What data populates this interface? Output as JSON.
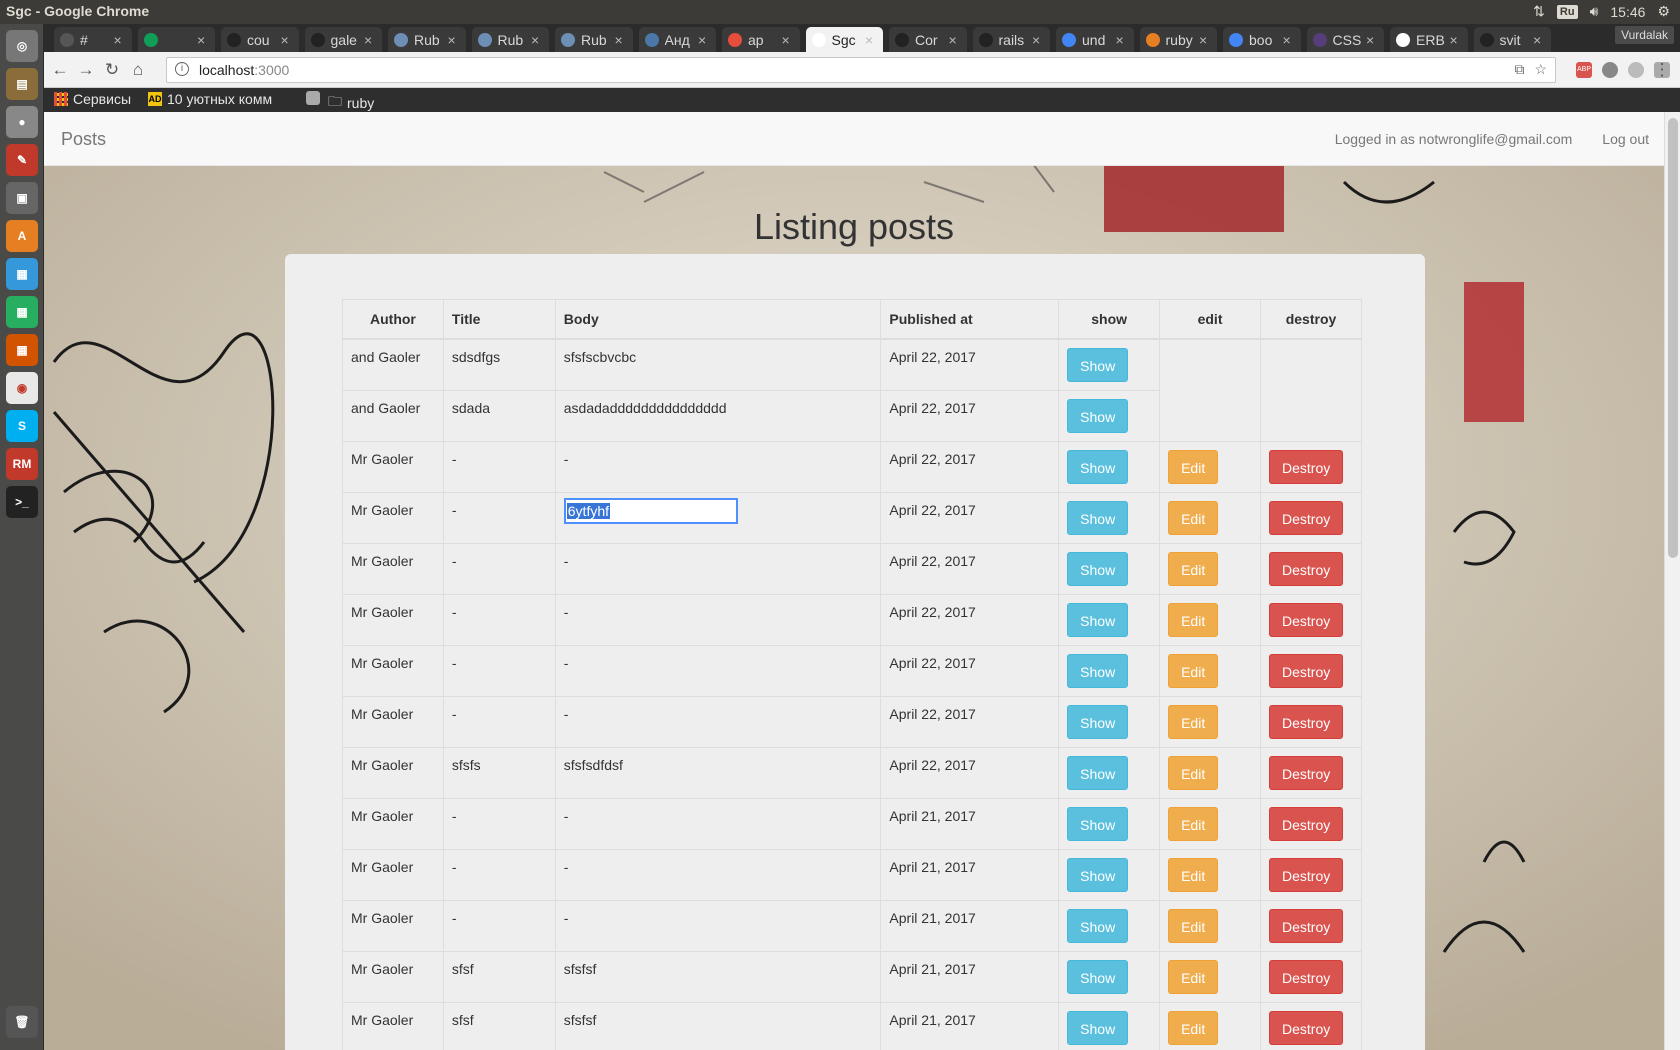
{
  "system": {
    "window_title": "Sgc - Google Chrome",
    "keyboard_layout": "Ru",
    "clock": "15:46",
    "profile": "Vurdalak"
  },
  "tabs": [
    {
      "label": "#",
      "active": false
    },
    {
      "label": "",
      "active": false
    },
    {
      "label": "cou",
      "active": false
    },
    {
      "label": "gale",
      "active": false
    },
    {
      "label": "Rub",
      "active": false
    },
    {
      "label": "Rub",
      "active": false
    },
    {
      "label": "Rub",
      "active": false
    },
    {
      "label": "Анд",
      "active": false
    },
    {
      "label": "ap",
      "active": false
    },
    {
      "label": "Sgc",
      "active": true
    },
    {
      "label": "Cor",
      "active": false
    },
    {
      "label": "rails",
      "active": false
    },
    {
      "label": "und",
      "active": false
    },
    {
      "label": "ruby",
      "active": false
    },
    {
      "label": "boo",
      "active": false
    },
    {
      "label": "CSS",
      "active": false
    },
    {
      "label": "ERB",
      "active": false
    },
    {
      "label": "svit",
      "active": false
    }
  ],
  "address_bar": {
    "host": "localhost",
    "port": ":3000"
  },
  "bookmarks": {
    "apps": "Сервисы",
    "item2": "10 уютных комм",
    "folder": "ruby"
  },
  "app": {
    "brand": "Posts",
    "logged_in": "Logged in as notwronglife@gmail.com",
    "logout": "Log out"
  },
  "page": {
    "title": "Listing posts"
  },
  "table": {
    "headers": {
      "author": "Author",
      "title": "Title",
      "body": "Body",
      "published": "Published at",
      "show": "show",
      "edit": "edit",
      "destroy": "destroy"
    },
    "show_label": "Show",
    "edit_label": "Edit",
    "destroy_label": "Destroy",
    "rows": [
      {
        "author": "and Gaoler",
        "title": "sdsdfgs",
        "body": "sfsfscbvcbc",
        "published": "April 22, 2017",
        "editable": false
      },
      {
        "author": "and Gaoler",
        "title": "sdada",
        "body": "asdadaddddddddddddddd",
        "published": "April 22, 2017",
        "editable": false
      },
      {
        "author": "Mr Gaoler",
        "title": "-",
        "body": "-",
        "published": "April 22, 2017",
        "editable": true
      },
      {
        "author": "Mr Gaoler",
        "title": "-",
        "body": "6ytfyhf",
        "published": "April 22, 2017",
        "editable": true,
        "editing": true
      },
      {
        "author": "Mr Gaoler",
        "title": "-",
        "body": "-",
        "published": "April 22, 2017",
        "editable": true
      },
      {
        "author": "Mr Gaoler",
        "title": "-",
        "body": "-",
        "published": "April 22, 2017",
        "editable": true
      },
      {
        "author": "Mr Gaoler",
        "title": "-",
        "body": "-",
        "published": "April 22, 2017",
        "editable": true
      },
      {
        "author": "Mr Gaoler",
        "title": "-",
        "body": "-",
        "published": "April 22, 2017",
        "editable": true
      },
      {
        "author": "Mr Gaoler",
        "title": "sfsfs",
        "body": "sfsfsdfdsf",
        "published": "April 22, 2017",
        "editable": true
      },
      {
        "author": "Mr Gaoler",
        "title": "-",
        "body": "-",
        "published": "April 21, 2017",
        "editable": true
      },
      {
        "author": "Mr Gaoler",
        "title": "-",
        "body": "-",
        "published": "April 21, 2017",
        "editable": true
      },
      {
        "author": "Mr Gaoler",
        "title": "-",
        "body": "-",
        "published": "April 21, 2017",
        "editable": true
      },
      {
        "author": "Mr Gaoler",
        "title": "sfsf",
        "body": "sfsfsf",
        "published": "April 21, 2017",
        "editable": true
      },
      {
        "author": "Mr Gaoler",
        "title": "sfsf",
        "body": "sfsfsf",
        "published": "April 21, 2017",
        "editable": true
      }
    ]
  },
  "colors": {
    "show": "#5bc0de",
    "edit": "#f0ad4e",
    "destroy": "#d9534f",
    "navbar": "#f8f8f8",
    "panel": "#eeeeee"
  }
}
